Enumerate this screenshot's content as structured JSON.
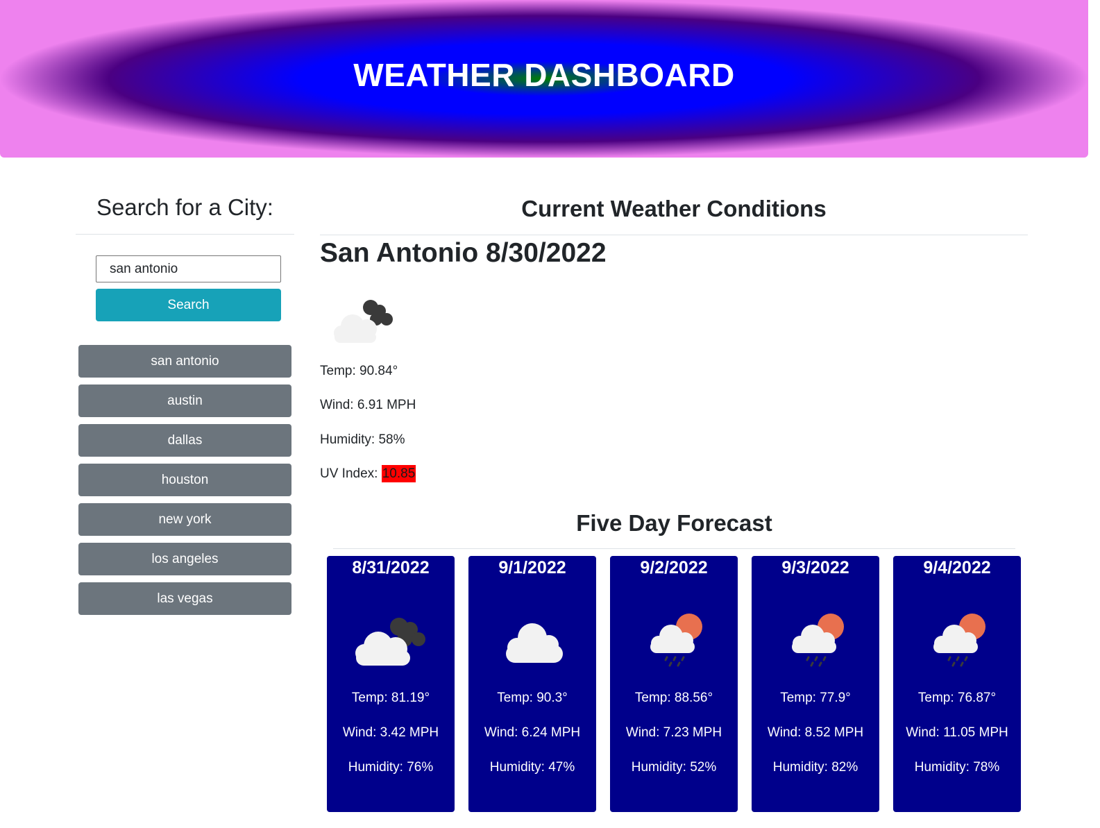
{
  "header": {
    "title": "WEATHER DASHBOARD"
  },
  "sidebar": {
    "title": "Search for a City:",
    "search_value": "san antonio",
    "search_button": "Search",
    "history": [
      "san antonio",
      "austin",
      "dallas",
      "houston",
      "new york",
      "los angeles",
      "las vegas"
    ]
  },
  "current": {
    "section_title": "Current Weather Conditions",
    "city_date": "San Antonio 8/30/2022",
    "icon": "broken-clouds-icon",
    "temp": "Temp: 90.84°",
    "wind": "Wind: 6.91 MPH",
    "humidity": "Humidity: 58%",
    "uv_label": "UV Index: ",
    "uv_value": "10.85",
    "uv_color": "#ff0000"
  },
  "forecast": {
    "title": "Five Day Forecast",
    "days": [
      {
        "date": "8/31/2022",
        "icon": "broken-clouds-icon",
        "temp": "Temp: 81.19°",
        "wind": "Wind: 3.42 MPH",
        "humidity": "Humidity: 76%"
      },
      {
        "date": "9/1/2022",
        "icon": "cloud-icon",
        "temp": "Temp: 90.3°",
        "wind": "Wind: 6.24 MPH",
        "humidity": "Humidity: 47%"
      },
      {
        "date": "9/2/2022",
        "icon": "rain-sun-icon",
        "temp": "Temp: 88.56°",
        "wind": "Wind: 7.23 MPH",
        "humidity": "Humidity: 52%"
      },
      {
        "date": "9/3/2022",
        "icon": "rain-sun-icon",
        "temp": "Temp: 77.9°",
        "wind": "Wind: 8.52 MPH",
        "humidity": "Humidity: 82%"
      },
      {
        "date": "9/4/2022",
        "icon": "rain-sun-icon",
        "temp": "Temp: 76.87°",
        "wind": "Wind: 11.05 MPH",
        "humidity": "Humidity: 78%"
      }
    ]
  },
  "colors": {
    "card_bg": "#00008b",
    "search_button": "#17a2b8",
    "history_button": "#6c757d"
  }
}
